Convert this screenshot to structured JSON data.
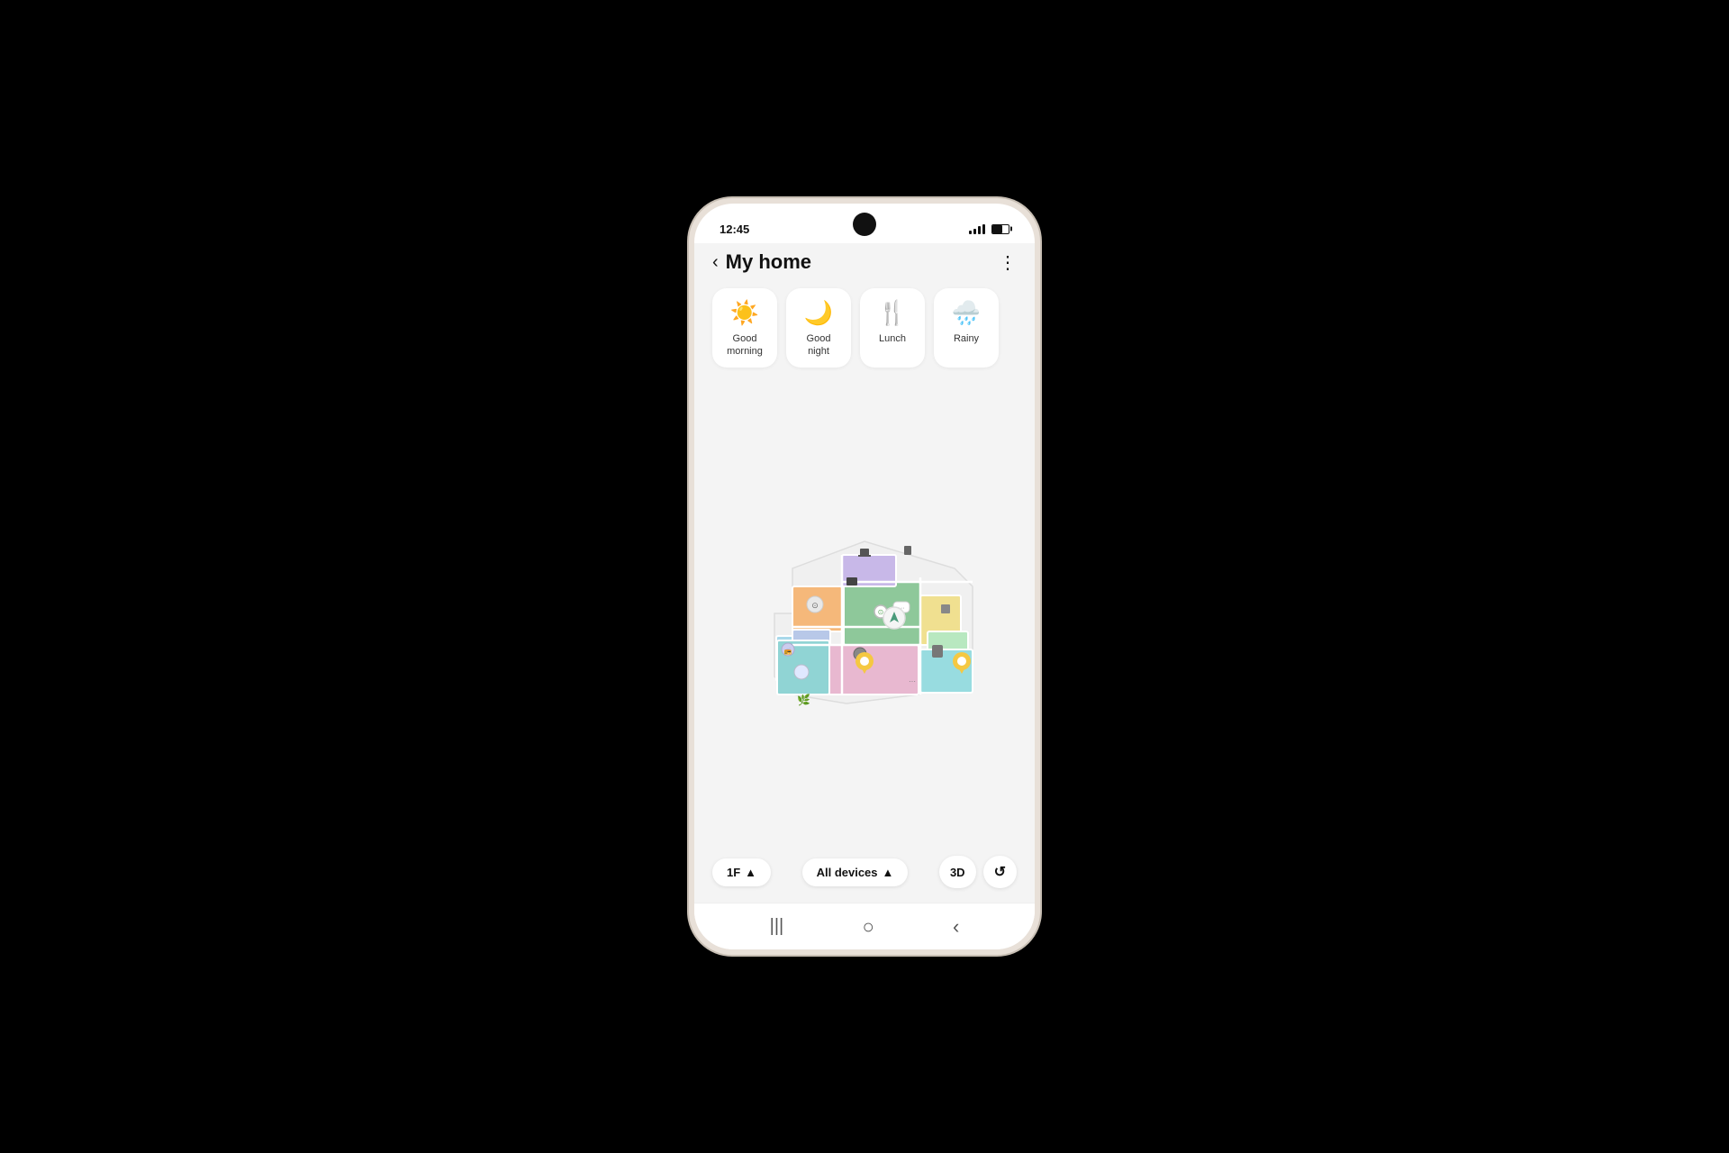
{
  "phone": {
    "time": "12:45"
  },
  "header": {
    "title": "My home",
    "back_label": "‹",
    "more_label": "⋮"
  },
  "scenes": [
    {
      "id": "good-morning",
      "icon": "☀️",
      "label": "Good\nmorning"
    },
    {
      "id": "good-night",
      "icon": "🌙",
      "label": "Good\nnight"
    },
    {
      "id": "lunch",
      "icon": "🍴",
      "label": "Lunch"
    },
    {
      "id": "rainy",
      "icon": "🌧️",
      "label": "Rainy"
    }
  ],
  "controls": {
    "floor": "1F",
    "floor_icon": "▲",
    "devices": "All devices",
    "devices_icon": "▲",
    "view_3d": "3D",
    "view_rotate": "↺"
  },
  "nav": {
    "recent": "|||",
    "home": "○",
    "back": "‹"
  }
}
